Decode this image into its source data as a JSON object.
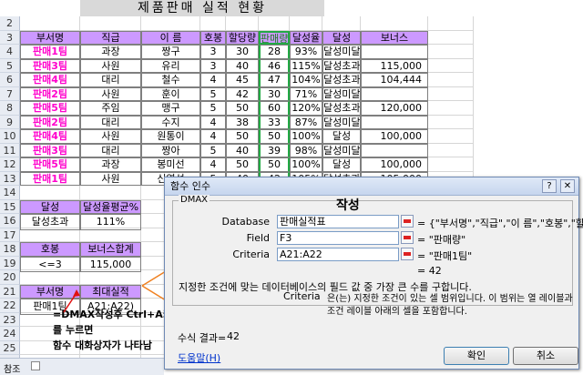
{
  "title": "제품판매 실적 현황",
  "row_numbers": [
    "2",
    "3",
    "4",
    "5",
    "6",
    "7",
    "8",
    "9",
    "10",
    "11",
    "12",
    "13",
    "14",
    "15",
    "16",
    "17",
    "18",
    "19",
    "20",
    "21",
    "22",
    "23",
    "24",
    "25",
    "26"
  ],
  "main_table": {
    "headers": [
      "부서명",
      "직급",
      "이 름",
      "호봉",
      "할당량",
      "판매량",
      "달성율",
      "달성",
      "보너스"
    ],
    "rows": [
      [
        "판매1팀",
        "과장",
        "짱구",
        "3",
        "30",
        "28",
        "93%",
        "달성미달",
        ""
      ],
      [
        "판매3팀",
        "사원",
        "유리",
        "3",
        "40",
        "46",
        "115%",
        "달성초과",
        "115,000"
      ],
      [
        "판매4팀",
        "대리",
        "철수",
        "4",
        "45",
        "47",
        "104%",
        "달성초과",
        "104,444"
      ],
      [
        "판매2팀",
        "사원",
        "훈이",
        "5",
        "42",
        "30",
        "71%",
        "달성미달",
        ""
      ],
      [
        "판매5팀",
        "주임",
        "맹구",
        "5",
        "50",
        "60",
        "120%",
        "달성초과",
        "120,000"
      ],
      [
        "판매2팀",
        "대리",
        "수지",
        "4",
        "38",
        "33",
        "87%",
        "달성미달",
        ""
      ],
      [
        "판매4팀",
        "사원",
        "원통이",
        "4",
        "50",
        "50",
        "100%",
        "달성",
        "100,000"
      ],
      [
        "판매3팀",
        "대리",
        "짱아",
        "5",
        "40",
        "39",
        "98%",
        "달성미달",
        ""
      ],
      [
        "판매5팀",
        "과장",
        "봉미선",
        "4",
        "50",
        "50",
        "100%",
        "달성",
        "100,000"
      ],
      [
        "판매1팀",
        "사원",
        "신영석",
        "5",
        "40",
        "42",
        "105%",
        "달성초과",
        "105,000"
      ]
    ]
  },
  "crit1": {
    "h1": "달성",
    "h2": "달성율평균%",
    "v1": "달성초과",
    "v2": "111%"
  },
  "crit2": {
    "h1": "호봉",
    "h2": "보너스합계",
    "v1": "<=3",
    "v2": "115,000"
  },
  "crit3": {
    "h1": "부서명",
    "h2": "최대실적",
    "v1": "판매1팀",
    "v2": "A21:A22)"
  },
  "notes": [
    "=DMAX작성후 Ctrl+A키",
    "를 누르면",
    "함수 대화상자가 나타남"
  ],
  "sheet_tab": "참조",
  "dialog": {
    "title": "함수 인수",
    "func_name": "DMAX",
    "fields": [
      {
        "label": "Database",
        "value": "판매실적표",
        "result": "= {\"부서명\",\"직급\",\"이 름\",\"호봉\",\"할..."
      },
      {
        "label": "Field",
        "value": "F3",
        "result": "= \"판매량\""
      },
      {
        "label": "Criteria",
        "value": "A21:A22",
        "result": "= \"판매1팀\""
      }
    ],
    "value_result": "= 42",
    "description": "지정한 조건에 맞는 데이터베이스의 필드 값 중 가장 큰 수를 구합니다.",
    "arg_label": "Criteria",
    "arg_desc_1": "은(는) 지정한 조건이 있는 셀 범위입니다. 이 범위는 열 레이블과",
    "arg_desc_2": "조건 레이블 아래의 셀을 포함합니다.",
    "formula_result_label": "수식 결과=",
    "formula_result": "42",
    "help_link": "도움말(H)",
    "ok": "확인",
    "cancel": "취소",
    "annotation": "작성"
  }
}
